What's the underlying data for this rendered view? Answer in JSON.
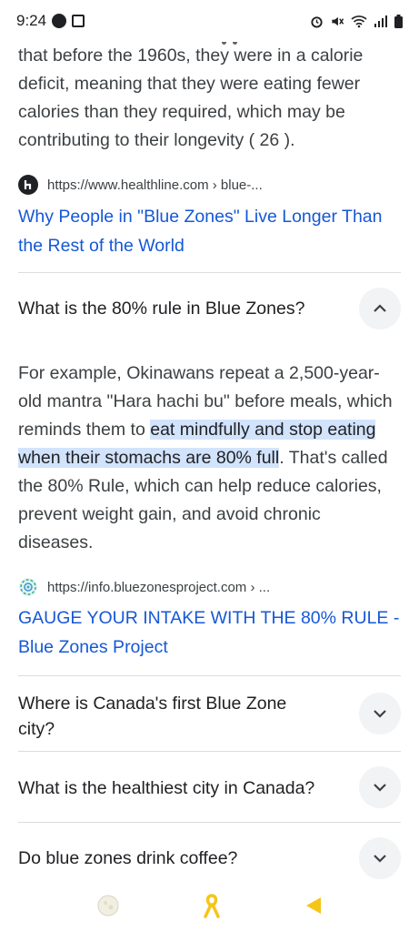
{
  "status": {
    "time": "9:24"
  },
  "top_paragraph": {
    "lines": [
      "that before the 1960s, they were in a calorie",
      "deficit, meaning that they were eating fewer",
      "calories than they required, which may be",
      "contributing to their longevity ( 26 )."
    ]
  },
  "source1": {
    "url": "https://www.healthline.com › blue-...",
    "title_line1": "Why People in \"Blue Zones\" Live Longer Than",
    "title_line2": "the Rest of the World"
  },
  "faq_expanded": {
    "question": "What is the 80% rule in Blue Zones?",
    "answer_before": "For example, Okinawans repeat a 2,500-year-old mantra \"Hara hachi bu\" before meals, which reminds them to ",
    "answer_highlight": "eat mindfully and stop eating when their stomachs are 80% full",
    "answer_after": ". That's called the 80% Rule, which can help reduce calories, prevent weight gain, and avoid chronic diseases."
  },
  "source2": {
    "url": "https://info.bluezonesproject.com › ...",
    "title_line1": "GAUGE YOUR INTAKE WITH THE 80% RULE -",
    "title_line2": "Blue Zones Project"
  },
  "faq_collapsed": [
    {
      "question": "Where is Canada's first Blue Zone city?"
    },
    {
      "question": "What is the healthiest city in Canada?"
    },
    {
      "question": "Do blue zones drink coffee?"
    }
  ],
  "colors": {
    "link": "#1558d6",
    "highlight": "#d2e3fc",
    "nav_accent": "#f5c518"
  },
  "icons": {
    "status": [
      "messenger-icon",
      "image-icon",
      "alarm-icon",
      "mute-icon",
      "wifi-icon",
      "signal-icon",
      "battery-icon"
    ],
    "nav": [
      "moon-icon",
      "ribbon-icon",
      "back-triangle-icon"
    ]
  }
}
